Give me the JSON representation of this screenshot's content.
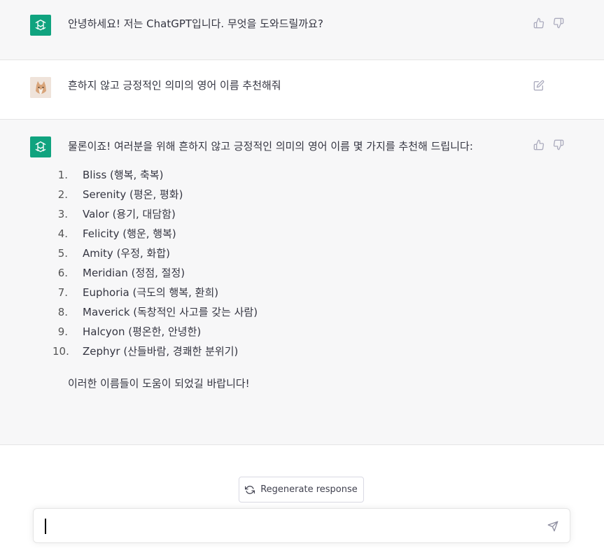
{
  "messages": [
    {
      "role": "assistant",
      "text": "안녕하세요! 저는 ChatGPT입니다. 무엇을 도와드릴까요?"
    },
    {
      "role": "user",
      "text": "흔하지 않고 긍정적인 의미의 영어 이름 추천해줘"
    },
    {
      "role": "assistant",
      "intro": "물론이죠! 여러분을 위해 흔하지 않고 긍정적인 의미의 영어 이름 몇 가지를 추천해 드립니다:",
      "list": [
        {
          "num": "1.",
          "text": "Bliss (행복, 축복)"
        },
        {
          "num": "2.",
          "text": "Serenity (평온, 평화)"
        },
        {
          "num": "3.",
          "text": "Valor (용기, 대담함)"
        },
        {
          "num": "4.",
          "text": "Felicity (행운, 행복)"
        },
        {
          "num": "5.",
          "text": "Amity (우정, 화합)"
        },
        {
          "num": "6.",
          "text": "Meridian (정점, 절정)"
        },
        {
          "num": "7.",
          "text": "Euphoria (극도의 행복, 환희)"
        },
        {
          "num": "8.",
          "text": "Maverick (독창적인 사고를 갖는 사람)"
        },
        {
          "num": "9.",
          "text": "Halcyon (평온한, 안녕한)"
        },
        {
          "num": "10.",
          "text": "Zephyr (산들바람, 경쾌한 분위기)"
        }
      ],
      "closing": "이러한 이름들이 도움이 되었길 바랍니다!"
    }
  ],
  "regenerate_label": "Regenerate response",
  "input": {
    "value": "",
    "placeholder": ""
  },
  "icons": {
    "assistant_avatar": "openai-logo-icon",
    "user_avatar": "cat-photo-avatar",
    "like": "thumbs-up-icon",
    "dislike": "thumbs-down-icon",
    "edit": "edit-icon",
    "regenerate": "refresh-icon",
    "send": "send-icon"
  },
  "colors": {
    "accent": "#10a37f",
    "assistant_bg": "#f7f7f8",
    "text": "#343541",
    "icon": "#acacbe"
  }
}
